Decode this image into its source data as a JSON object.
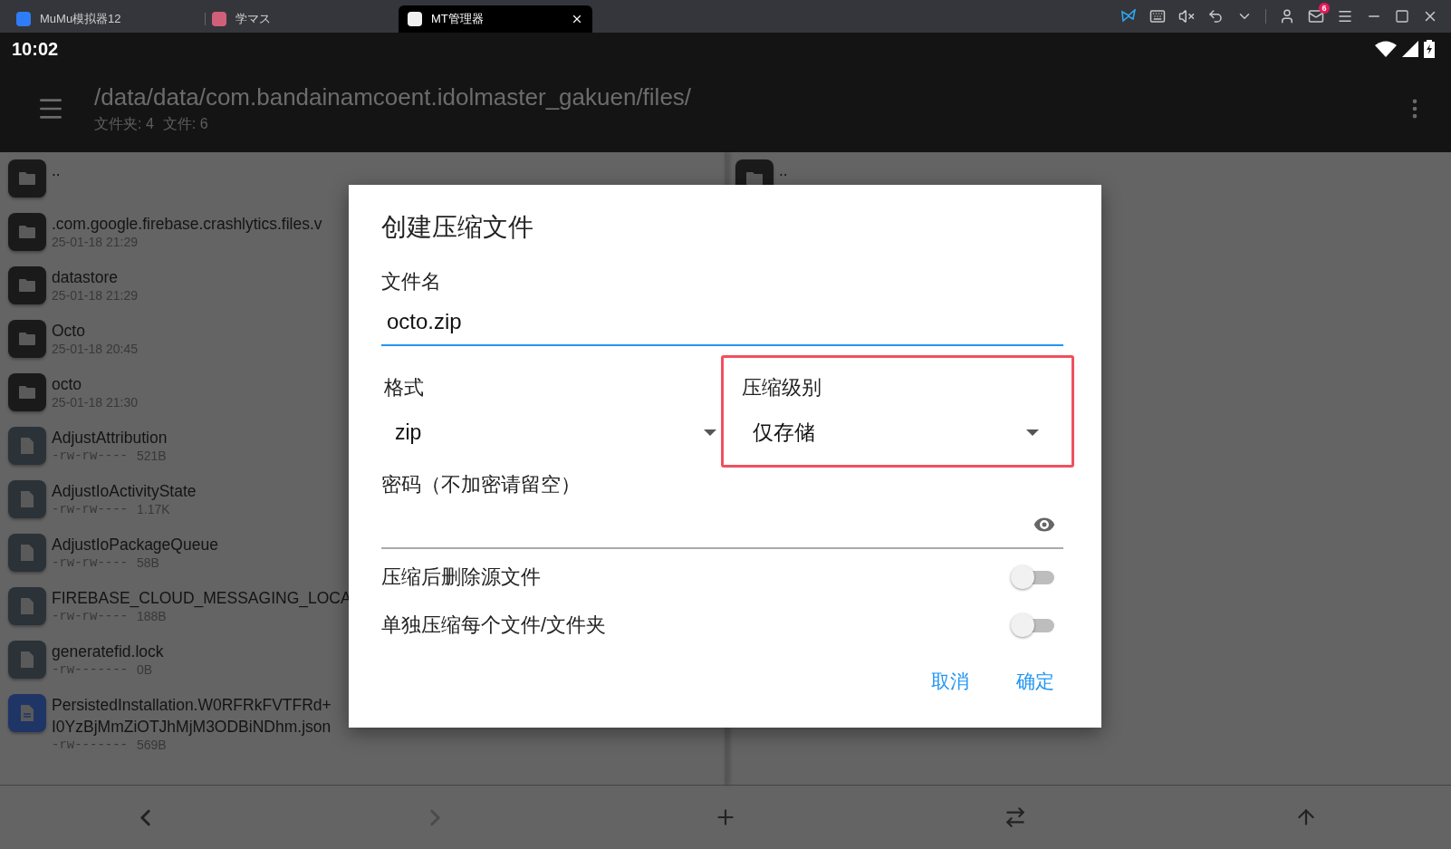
{
  "window": {
    "tabs": [
      {
        "label": "MuMu模拟器12",
        "kind": "mumu",
        "selected": false
      },
      {
        "label": "学マス",
        "kind": "game",
        "selected": false
      },
      {
        "label": "MT管理器",
        "kind": "mt",
        "selected": true
      }
    ],
    "mail_badge": "6"
  },
  "status_bar": {
    "time": "10:02"
  },
  "toolbar": {
    "path": "/data/data/com.bandainamcoent.idolmaster_gakuen/files/",
    "counts": [
      "文件夹: 4",
      "文件: 6"
    ]
  },
  "left_pane": {
    "items": [
      {
        "kind": "folder",
        "name": ".."
      },
      {
        "kind": "folder",
        "name": ".com.google.firebase.crashlytics.files.v",
        "date": "25-01-18 21:29"
      },
      {
        "kind": "folder",
        "name": "datastore",
        "date": "25-01-18 21:29"
      },
      {
        "kind": "folder",
        "name": "Octo",
        "date": "25-01-18 20:45"
      },
      {
        "kind": "folder",
        "name": "octo",
        "date": "25-01-18 21:30"
      },
      {
        "kind": "file",
        "name": "AdjustAttribution",
        "perms": "-rw-rw----",
        "size": "521B"
      },
      {
        "kind": "file",
        "name": "AdjustIoActivityState",
        "perms": "-rw-rw----",
        "size": "1.17K"
      },
      {
        "kind": "file",
        "name": "AdjustIoPackageQueue",
        "perms": "-rw-rw----",
        "size": "58B"
      },
      {
        "kind": "file",
        "name": "FIREBASE_CLOUD_MESSAGING_LOCA",
        "perms": "-rw-rw----",
        "size": "188B"
      },
      {
        "kind": "file",
        "name": "generatefid.lock",
        "perms": "-rw-------",
        "size": "0B"
      },
      {
        "kind": "document",
        "name": "PersistedInstallation.W0RFRkFVTFRd+",
        "name_line2": "I0YzBjMmZiOTJhMjM3ODBiNDhm.json",
        "perms": "-rw-------",
        "size": "569B"
      }
    ]
  },
  "right_pane": {
    "items": [
      {
        "kind": "folder",
        "name": ".."
      }
    ]
  },
  "dialog": {
    "title": "创建压缩文件",
    "filename_label": "文件名",
    "filename_value": "octo.zip",
    "format_label": "格式",
    "format_value": "zip",
    "level_label": "压缩级别",
    "level_value": "仅存储",
    "level_highlighted": true,
    "password_label": "密码（不加密请留空）",
    "toggles": [
      {
        "label": "压缩后删除源文件",
        "on": false
      },
      {
        "label": "单独压缩每个文件/文件夹",
        "on": false
      }
    ],
    "buttons": [
      "取消",
      "确定"
    ]
  },
  "bottom_bar": [
    {
      "kind": "back",
      "disabled": false
    },
    {
      "kind": "forward",
      "disabled": true
    },
    {
      "kind": "add",
      "disabled": false
    },
    {
      "kind": "swap",
      "disabled": false
    },
    {
      "kind": "up",
      "disabled": false
    }
  ]
}
